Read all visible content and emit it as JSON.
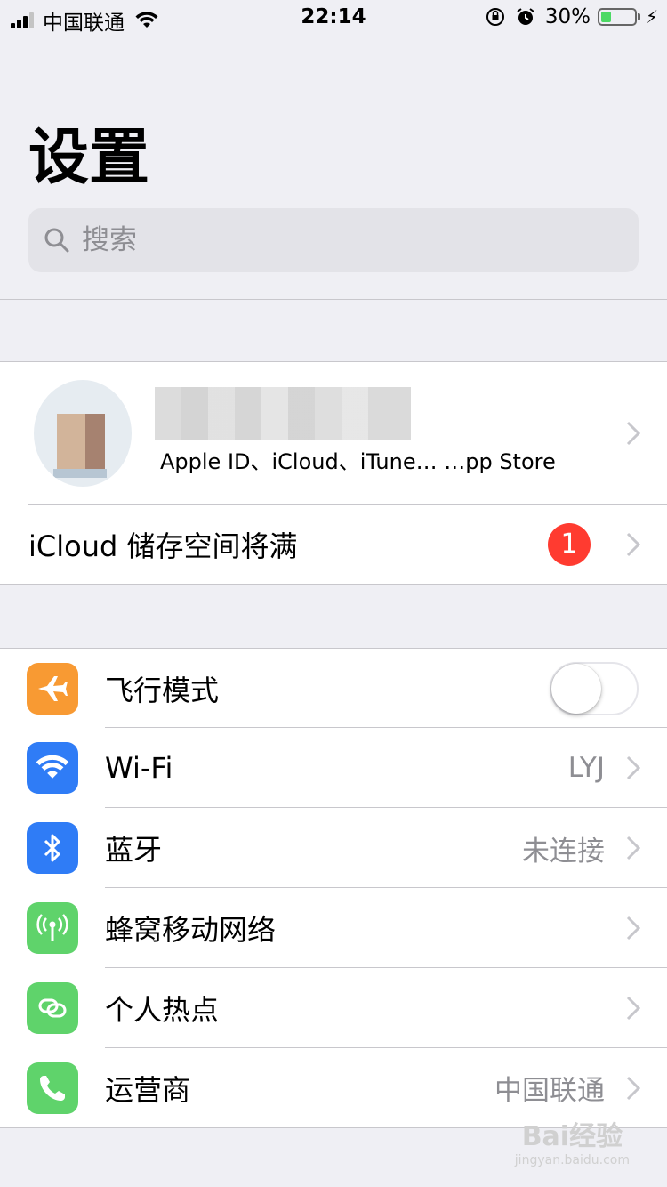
{
  "status_bar": {
    "carrier": "中国联通",
    "time": "22:14",
    "battery": "30%",
    "battery_level": 0.3
  },
  "header": {
    "title": "设置"
  },
  "search": {
    "placeholder": "搜索"
  },
  "account": {
    "subtitle": "Apple ID、iCloud、iTune… …pp Store"
  },
  "icloud": {
    "label": "iCloud 储存空间将满",
    "badge": "1"
  },
  "settings_items": [
    {
      "label": "飞行模式",
      "icon": "airplane-icon",
      "color": "#f89a33",
      "toggle": false
    },
    {
      "label": "Wi-Fi",
      "value": "LYJ",
      "icon": "wifi-icon",
      "color": "#2f7cf6"
    },
    {
      "label": "蓝牙",
      "value": "未连接",
      "icon": "bluetooth-icon",
      "color": "#2f7cf6"
    },
    {
      "label": "蜂窝移动网络",
      "icon": "cellular-icon",
      "color": "#5fd36b"
    },
    {
      "label": "个人热点",
      "icon": "hotspot-icon",
      "color": "#5fd36b"
    },
    {
      "label": "运营商",
      "value": "中国联通",
      "icon": "phone-icon",
      "color": "#5fd36b"
    }
  ],
  "watermark": {
    "text": "Bai经验",
    "url": "jingyan.baidu.com"
  }
}
